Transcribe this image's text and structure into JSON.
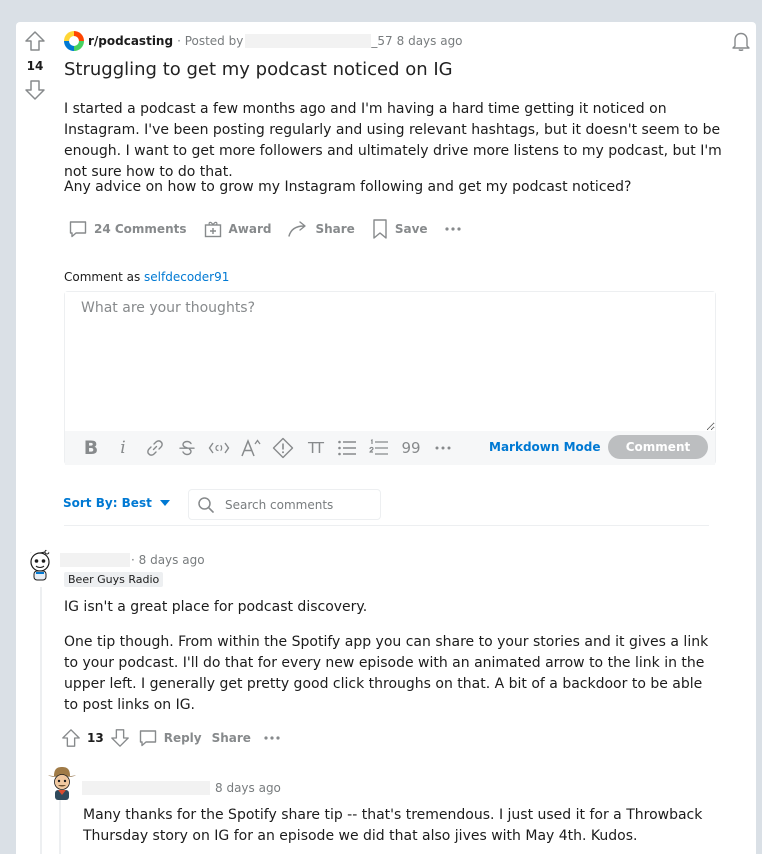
{
  "post": {
    "score": "14",
    "subreddit": "r/podcasting",
    "posted_by_prefix": "· Posted by",
    "author_suffix": "_57",
    "time": "8 days ago",
    "title": "Struggling to get my podcast noticed on IG",
    "body": [
      "I started a podcast a few months ago and I'm having a hard time getting it noticed on Instagram. I've been posting regularly and using relevant hashtags, but it doesn't seem to be enough. I want to get more followers and ultimately drive more listens to my podcast, but I'm not sure how to do that.",
      "Any advice on how to grow my Instagram following and get my podcast noticed?"
    ],
    "actions": {
      "comments": "24 Comments",
      "award": "Award",
      "share": "Share",
      "save": "Save"
    }
  },
  "composer": {
    "comment_as_label": "Comment as",
    "username": "selfdecoder91",
    "placeholder": "What are your thoughts?",
    "markdown_mode": "Markdown Mode",
    "submit_label": "Comment",
    "toolbar": {
      "bold": "B",
      "italic": "i",
      "heading": "TT",
      "quote": "99"
    }
  },
  "sort": {
    "label": "Sort By: Best",
    "search_placeholder": "Search comments"
  },
  "comments": [
    {
      "time": "· 8 days ago",
      "flair": "Beer Guys Radio",
      "body": [
        "IG isn't a great place for podcast discovery.",
        "One tip though. From within the Spotify app you can share to your stories and it gives a link to your podcast. I'll do that for every new episode with an animated arrow to the link in the upper left. I generally get pretty good click throughs on that. A bit of a backdoor to be able to post links on IG."
      ],
      "score": "13",
      "reply": "Reply",
      "share": "Share"
    },
    {
      "time": "8 days ago",
      "body": [
        "Many thanks for the Spotify share tip -- that's tremendous. I just used it for a Throwback Thursday story on IG for an episode we did that also jives with May 4th. Kudos."
      ]
    }
  ],
  "colors": {
    "background": "#dae0e6",
    "link_blue": "#0079d3",
    "meta_gray": "#787c7e",
    "action_gray": "#878a8c",
    "disabled_button": "#bcbec0"
  }
}
